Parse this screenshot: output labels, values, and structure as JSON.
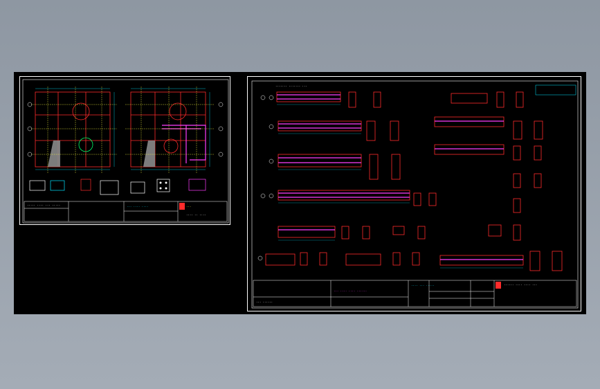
{
  "colors": {
    "background": "#9aa3ad",
    "modelspace": "#000000",
    "frame": "#ffffff",
    "beam": "#ff2b2b",
    "rebar": "#ff3cff",
    "dimension": "#00e5ff",
    "grid": "#ffff3c",
    "hatch": "#8a8a8a",
    "green": "#00ff66"
  },
  "sheet_left": {
    "title_block": {
      "line1": "..... .... ... .....",
      "line2": "... .... ....",
      "line3": ".... .. ....",
      "stamp": "..."
    }
  },
  "sheet_right": {
    "header_note": "....... ....... ...",
    "title_block": {
      "line1": "...... .... .... ...",
      "line2": ".... ... .....",
      "line3": "... .... .... ......",
      "line4": "... ......"
    }
  },
  "icons": {
    "grid_bubble": "grid-bubble-icon",
    "north_arrow": "north-arrow-icon",
    "company_logo": "company-logo-icon"
  }
}
